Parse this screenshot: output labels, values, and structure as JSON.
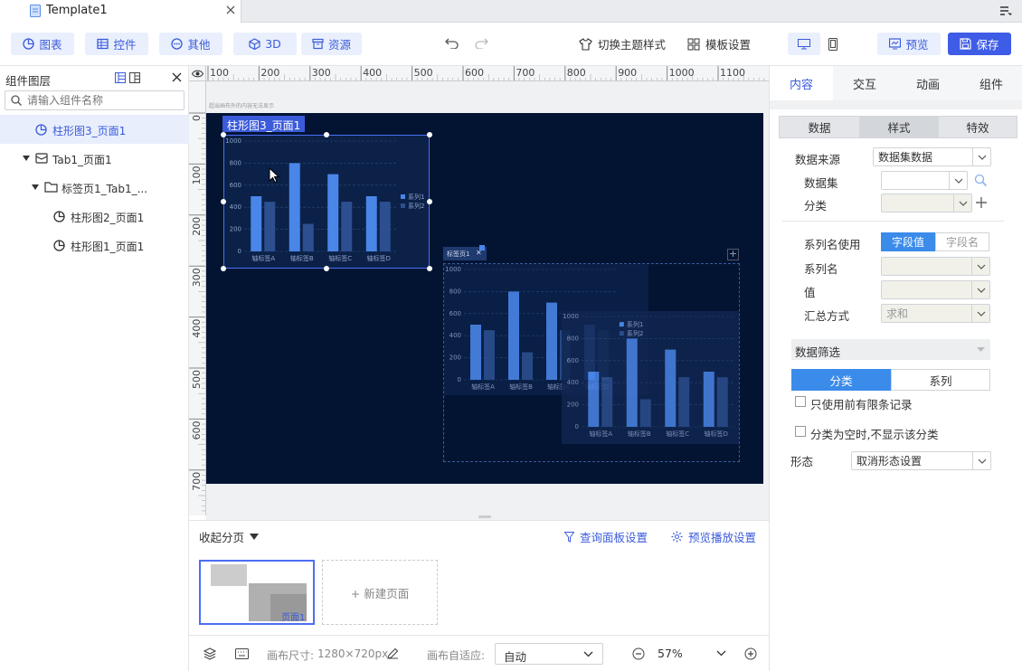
{
  "tabbar": {
    "doc_title": "Template1"
  },
  "toolbar": {
    "chart_label": "图表",
    "widget_label": "控件",
    "other_label": "其他",
    "three_d_label": "3D",
    "resource_label": "资源",
    "theme_label": "切换主题样式",
    "template_settings_label": "模板设置",
    "preview_label": "预览",
    "save_label": "保存"
  },
  "layers": {
    "title": "组件图层",
    "search_placeholder": "请输入组件名称",
    "items": [
      {
        "label": "柱形图3_页面1",
        "selected": true
      },
      {
        "label": "Tab1_页面1"
      },
      {
        "label": "标签页1_Tab1_..."
      },
      {
        "label": "柱形图2_页面1"
      },
      {
        "label": "柱形图1_页面1"
      }
    ]
  },
  "ruler": {
    "h_ticks": [
      "100",
      "200",
      "300",
      "400",
      "500",
      "600",
      "700",
      "800",
      "900",
      "1000",
      "1100"
    ],
    "v_ticks": [
      "0",
      "100",
      "200",
      "300",
      "400",
      "500",
      "600",
      "700"
    ],
    "hint": "超出画布外的内容无法显示"
  },
  "canvas": {
    "selected_label": "柱形图3_页面1",
    "tab_label": "标签页1"
  },
  "chart_data": [
    {
      "type": "bar",
      "categories": [
        "轴标签A",
        "轴标签B",
        "轴标签C",
        "轴标签D"
      ],
      "series": [
        {
          "name": "系列1",
          "values": [
            500,
            800,
            700,
            500
          ]
        },
        {
          "name": "系列2",
          "values": [
            450,
            250,
            450,
            450
          ]
        }
      ],
      "yticks": [
        "0",
        "200",
        "400",
        "600",
        "800",
        "1000"
      ],
      "ylim": [
        0,
        1000
      ],
      "colors": [
        "#4a86e8",
        "#2c4f8f"
      ]
    },
    {
      "type": "bar",
      "categories": [
        "轴标签A",
        "轴标签B",
        "轴标签C",
        "轴标签D"
      ],
      "series": [
        {
          "name": "系列1",
          "values": [
            500,
            800,
            700,
            500
          ]
        },
        {
          "name": "系列2",
          "values": [
            450,
            250,
            450,
            450
          ]
        }
      ],
      "yticks": [
        "0",
        "200",
        "400",
        "600",
        "800",
        "1000"
      ],
      "ylim": [
        0,
        1000
      ],
      "colors": [
        "#4a86e8",
        "#2c4f8f"
      ]
    },
    {
      "type": "bar",
      "categories": [
        "轴标签A",
        "轴标签B",
        "轴标签C",
        "轴标签D"
      ],
      "series": [
        {
          "name": "系列1",
          "values": [
            500,
            800,
            700,
            500
          ]
        },
        {
          "name": "系列2",
          "values": [
            450,
            250,
            450,
            450
          ]
        }
      ],
      "yticks": [
        "0",
        "200",
        "400",
        "600",
        "800",
        "1000"
      ],
      "ylim": [
        0,
        1000
      ],
      "colors": [
        "#4a86e8",
        "#2c4f8f"
      ]
    }
  ],
  "pages": {
    "collapse_label": "收起分页",
    "query_panel_label": "查询面板设置",
    "preview_play_label": "预览播放设置",
    "page1_label": "页面1",
    "new_page_label": "+ 新建页面"
  },
  "status": {
    "canvas_size_label": "画布尺寸:",
    "canvas_size_value": "1280×720px",
    "adapt_label": "画布自适应:",
    "adapt_value": "自动",
    "zoom_value": "57%"
  },
  "right": {
    "tabs": [
      "内容",
      "交互",
      "动画",
      "组件"
    ],
    "subtabs": [
      "数据",
      "样式",
      "特效"
    ],
    "source_label": "数据来源",
    "source_value": "数据集数据",
    "dataset_label": "数据集",
    "category_label": "分类",
    "series_name_use_label": "系列名使用",
    "field_value_btn": "字段值",
    "field_name_btn": "字段名",
    "series_name_label": "系列名",
    "value_label": "值",
    "summary_label": "汇总方式",
    "summary_value": "求和",
    "filter_title": "数据筛选",
    "filter_tab_category": "分类",
    "filter_tab_series": "系列",
    "only_top_label": "只使用前有限条记录",
    "hide_empty_label": "分类为空时,不显示该分类",
    "form_label": "形态",
    "form_value": "取消形态设置"
  },
  "colors": {
    "accent": "#3b5bdb",
    "canvas_bg": "#031433",
    "bar1": "#4a86e8",
    "bar2": "#2c4f8f"
  }
}
